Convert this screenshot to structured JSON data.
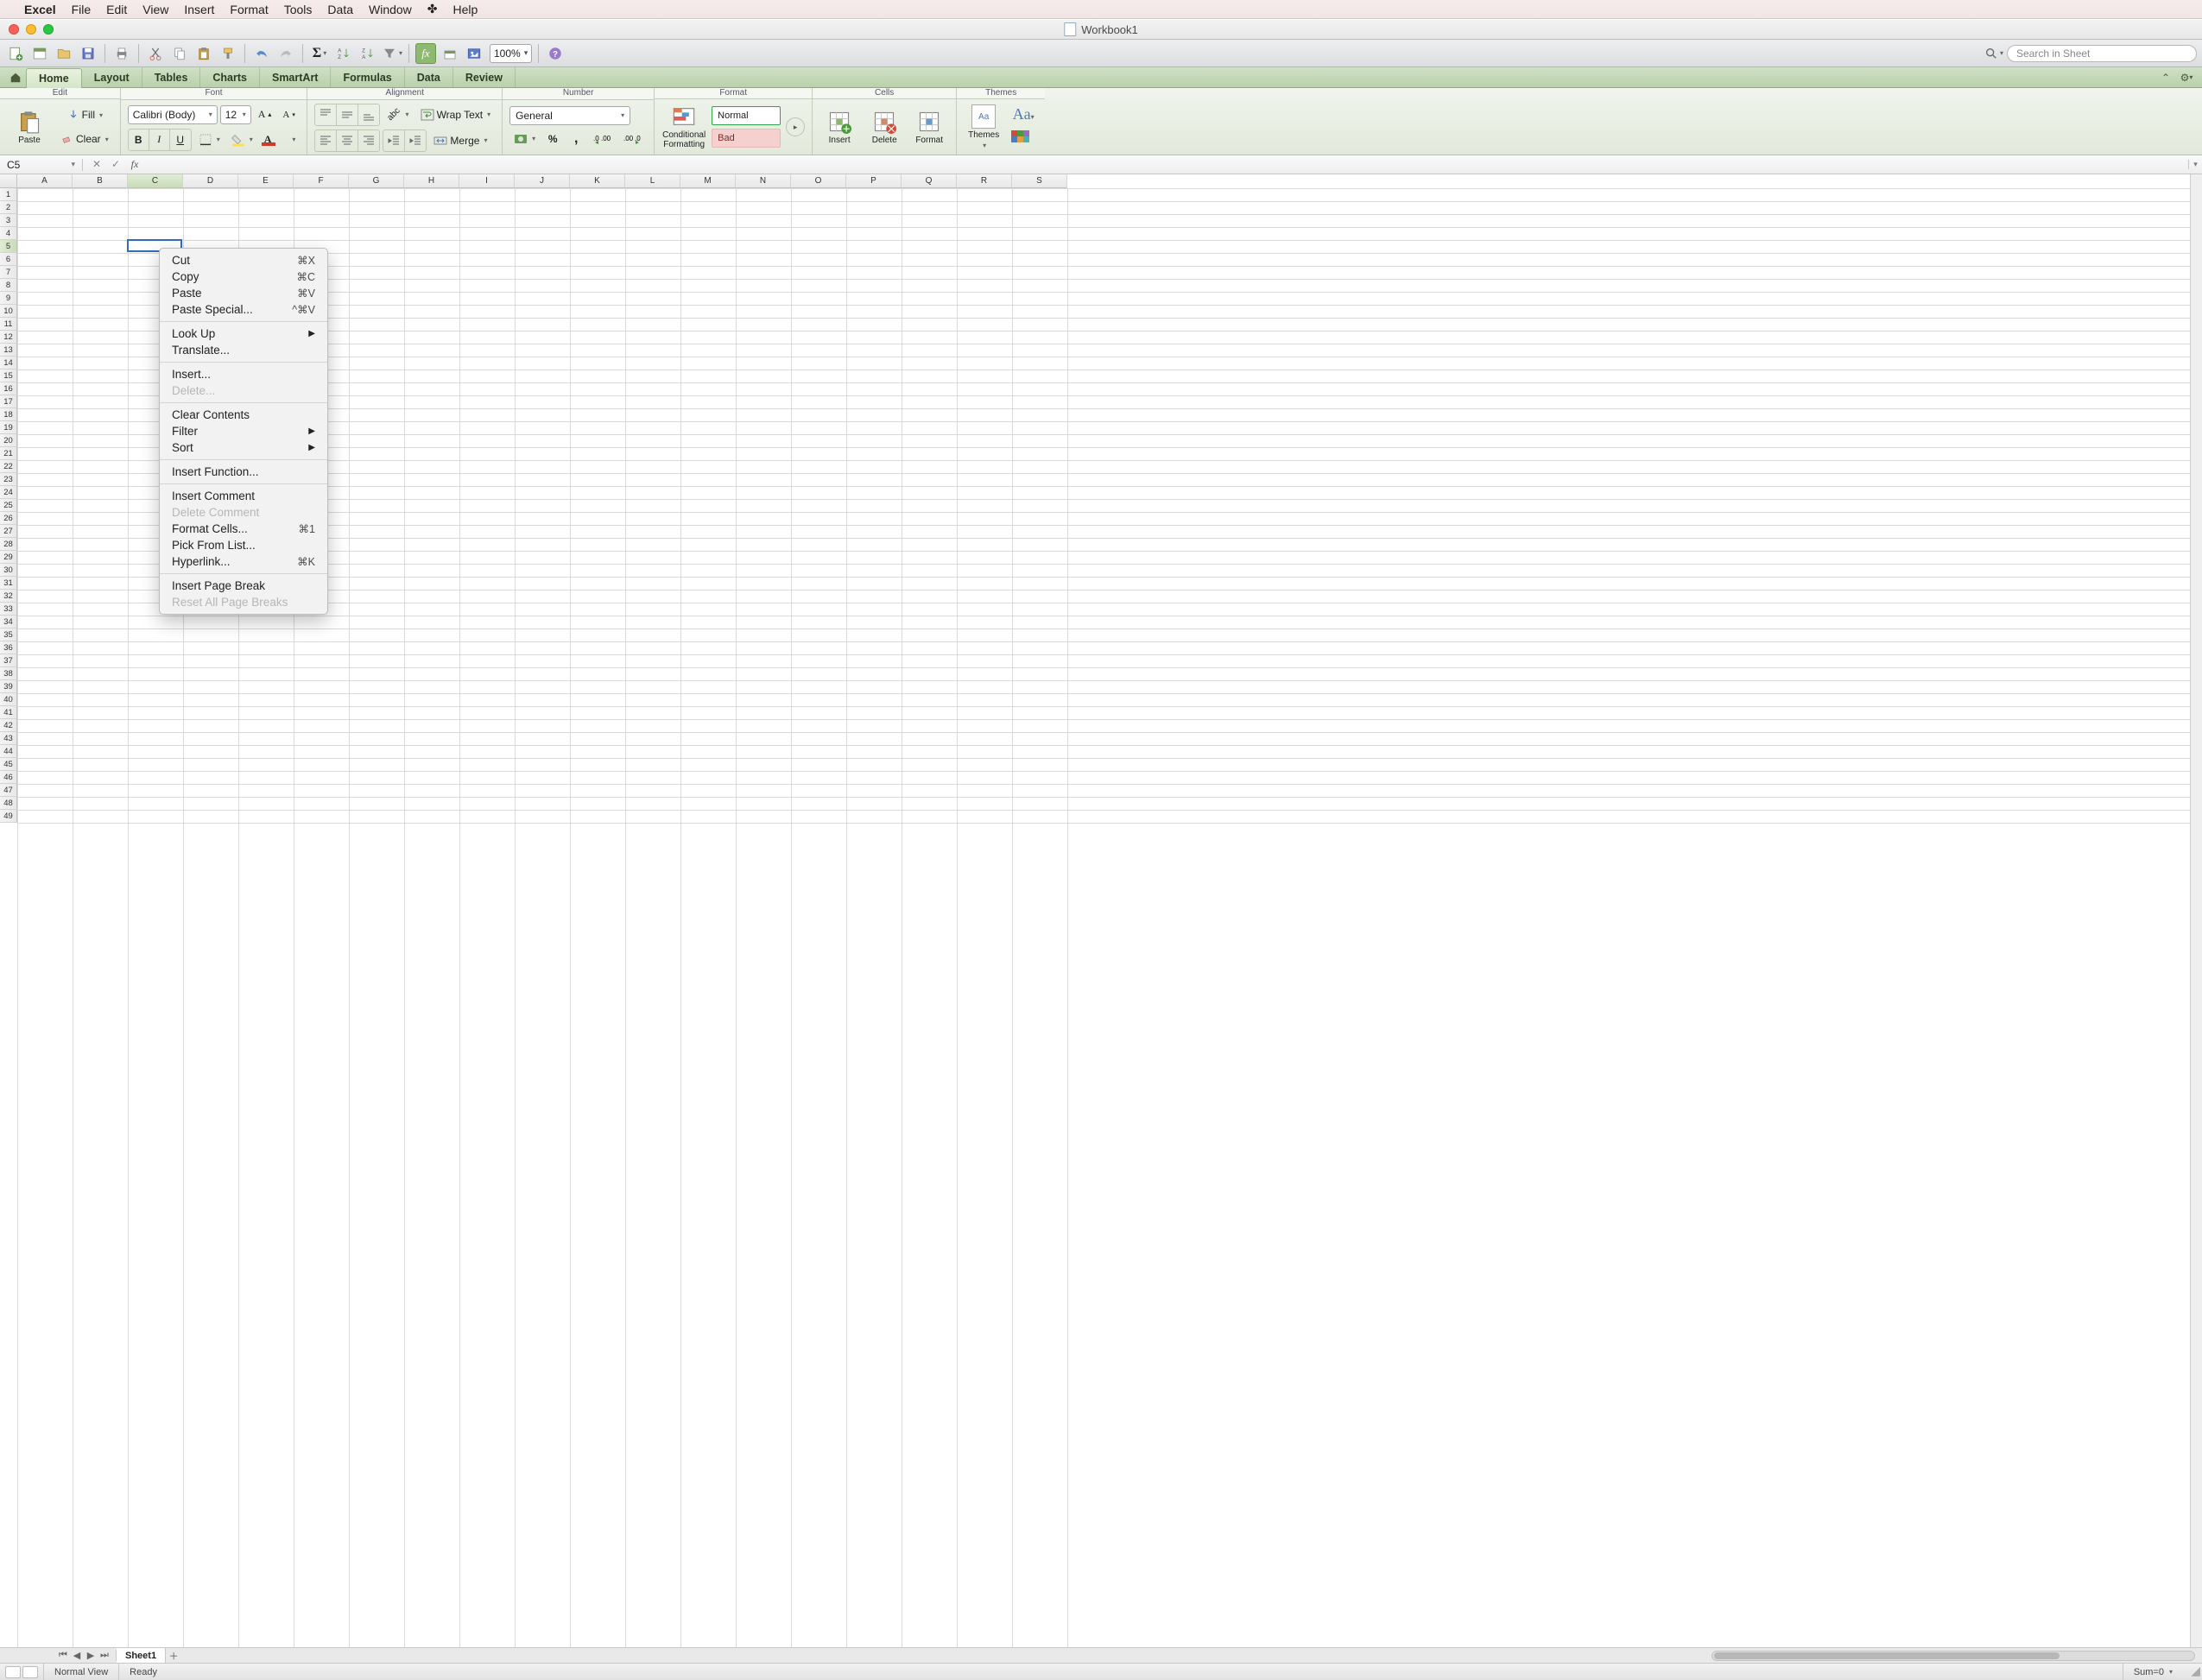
{
  "mac_menu": {
    "app": "Excel",
    "items": [
      "File",
      "Edit",
      "View",
      "Insert",
      "Format",
      "Tools",
      "Data",
      "Window"
    ],
    "help": "Help"
  },
  "window": {
    "title": "Workbook1"
  },
  "qat": {
    "zoom": "100%",
    "search_placeholder": "Search in Sheet"
  },
  "ribbon_tabs": [
    "Home",
    "Layout",
    "Tables",
    "Charts",
    "SmartArt",
    "Formulas",
    "Data",
    "Review"
  ],
  "ribbon_groups": [
    "Edit",
    "Font",
    "Alignment",
    "Number",
    "Format",
    "Cells",
    "Themes"
  ],
  "edit_group": {
    "paste": "Paste",
    "fill": "Fill",
    "clear": "Clear"
  },
  "font_group": {
    "font_name": "Calibri (Body)",
    "font_size": "12"
  },
  "alignment_group": {
    "wrap": "Wrap Text",
    "merge": "Merge"
  },
  "number_group": {
    "format": "General"
  },
  "format_group": {
    "conditional": "Conditional Formatting",
    "styles": {
      "normal": "Normal",
      "bad": "Bad"
    }
  },
  "cells_group": {
    "insert": "Insert",
    "delete": "Delete",
    "format": "Format"
  },
  "themes_group": {
    "themes": "Themes",
    "aa": "Aa"
  },
  "name_box": "C5",
  "columns": [
    "A",
    "B",
    "C",
    "D",
    "E",
    "F",
    "G",
    "H",
    "I",
    "J",
    "K",
    "L",
    "M",
    "N",
    "O",
    "P",
    "Q",
    "R",
    "S"
  ],
  "row_count": 49,
  "selected_col_index": 2,
  "selected_row_index": 4,
  "context_menu": [
    {
      "label": "Cut",
      "shortcut": "⌘X"
    },
    {
      "label": "Copy",
      "shortcut": "⌘C"
    },
    {
      "label": "Paste",
      "shortcut": "⌘V"
    },
    {
      "label": "Paste Special...",
      "shortcut": "^⌘V"
    },
    {
      "sep": true
    },
    {
      "label": "Look Up",
      "submenu": true
    },
    {
      "label": "Translate..."
    },
    {
      "sep": true
    },
    {
      "label": "Insert..."
    },
    {
      "label": "Delete...",
      "disabled": true
    },
    {
      "sep": true
    },
    {
      "label": "Clear Contents"
    },
    {
      "label": "Filter",
      "submenu": true
    },
    {
      "label": "Sort",
      "submenu": true
    },
    {
      "sep": true
    },
    {
      "label": "Insert Function..."
    },
    {
      "sep": true
    },
    {
      "label": "Insert Comment"
    },
    {
      "label": "Delete Comment",
      "disabled": true
    },
    {
      "label": "Format Cells...",
      "shortcut": "⌘1"
    },
    {
      "label": "Pick From List..."
    },
    {
      "label": "Hyperlink...",
      "shortcut": "⌘K"
    },
    {
      "sep": true
    },
    {
      "label": "Insert Page Break"
    },
    {
      "label": "Reset All Page Breaks",
      "disabled": true
    }
  ],
  "tabbar": {
    "sheet": "Sheet1"
  },
  "statusbar": {
    "view": "Normal View",
    "state": "Ready",
    "sum": "Sum=0"
  }
}
